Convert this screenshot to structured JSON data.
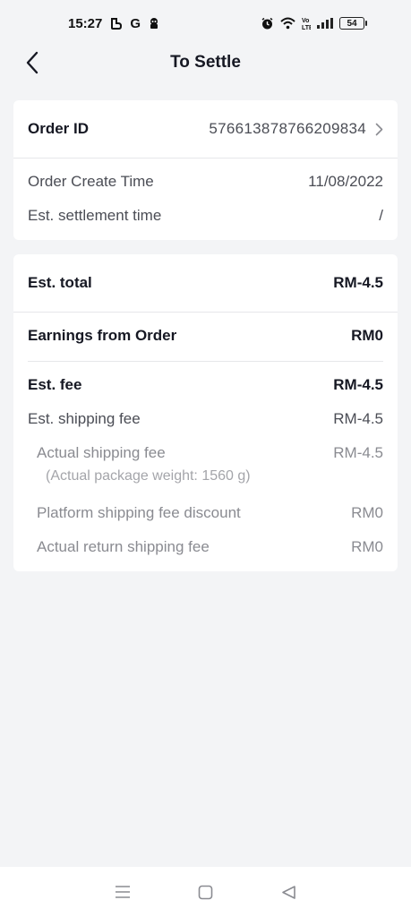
{
  "status_bar": {
    "time": "15:27",
    "battery": "54"
  },
  "header": {
    "title": "To Settle"
  },
  "order_card": {
    "order_id_label": "Order ID",
    "order_id_value": "576613878766209834",
    "create_time_label": "Order Create Time",
    "create_time_value": "11/08/2022",
    "settlement_time_label": "Est. settlement time",
    "settlement_time_value": "/"
  },
  "amount_card": {
    "est_total_label": "Est. total",
    "est_total_value": "RM-4.5",
    "earnings_label": "Earnings from Order",
    "earnings_value": "RM0",
    "est_fee_label": "Est. fee",
    "est_fee_value": "RM-4.5",
    "est_shipping_label": "Est. shipping fee",
    "est_shipping_value": "RM-4.5",
    "actual_shipping_label": "Actual shipping fee",
    "actual_shipping_value": "RM-4.5",
    "package_weight_note": "(Actual package weight: 1560 g)",
    "platform_discount_label": "Platform shipping fee discount",
    "platform_discount_value": "RM0",
    "return_shipping_label": "Actual return shipping fee",
    "return_shipping_value": "RM0"
  },
  "icons": {
    "back": "chevron-left-icon",
    "order_arrow": "chevron-right-icon",
    "nav_menu": "menu-icon",
    "nav_home": "square-home-icon",
    "nav_back": "triangle-back-icon"
  }
}
